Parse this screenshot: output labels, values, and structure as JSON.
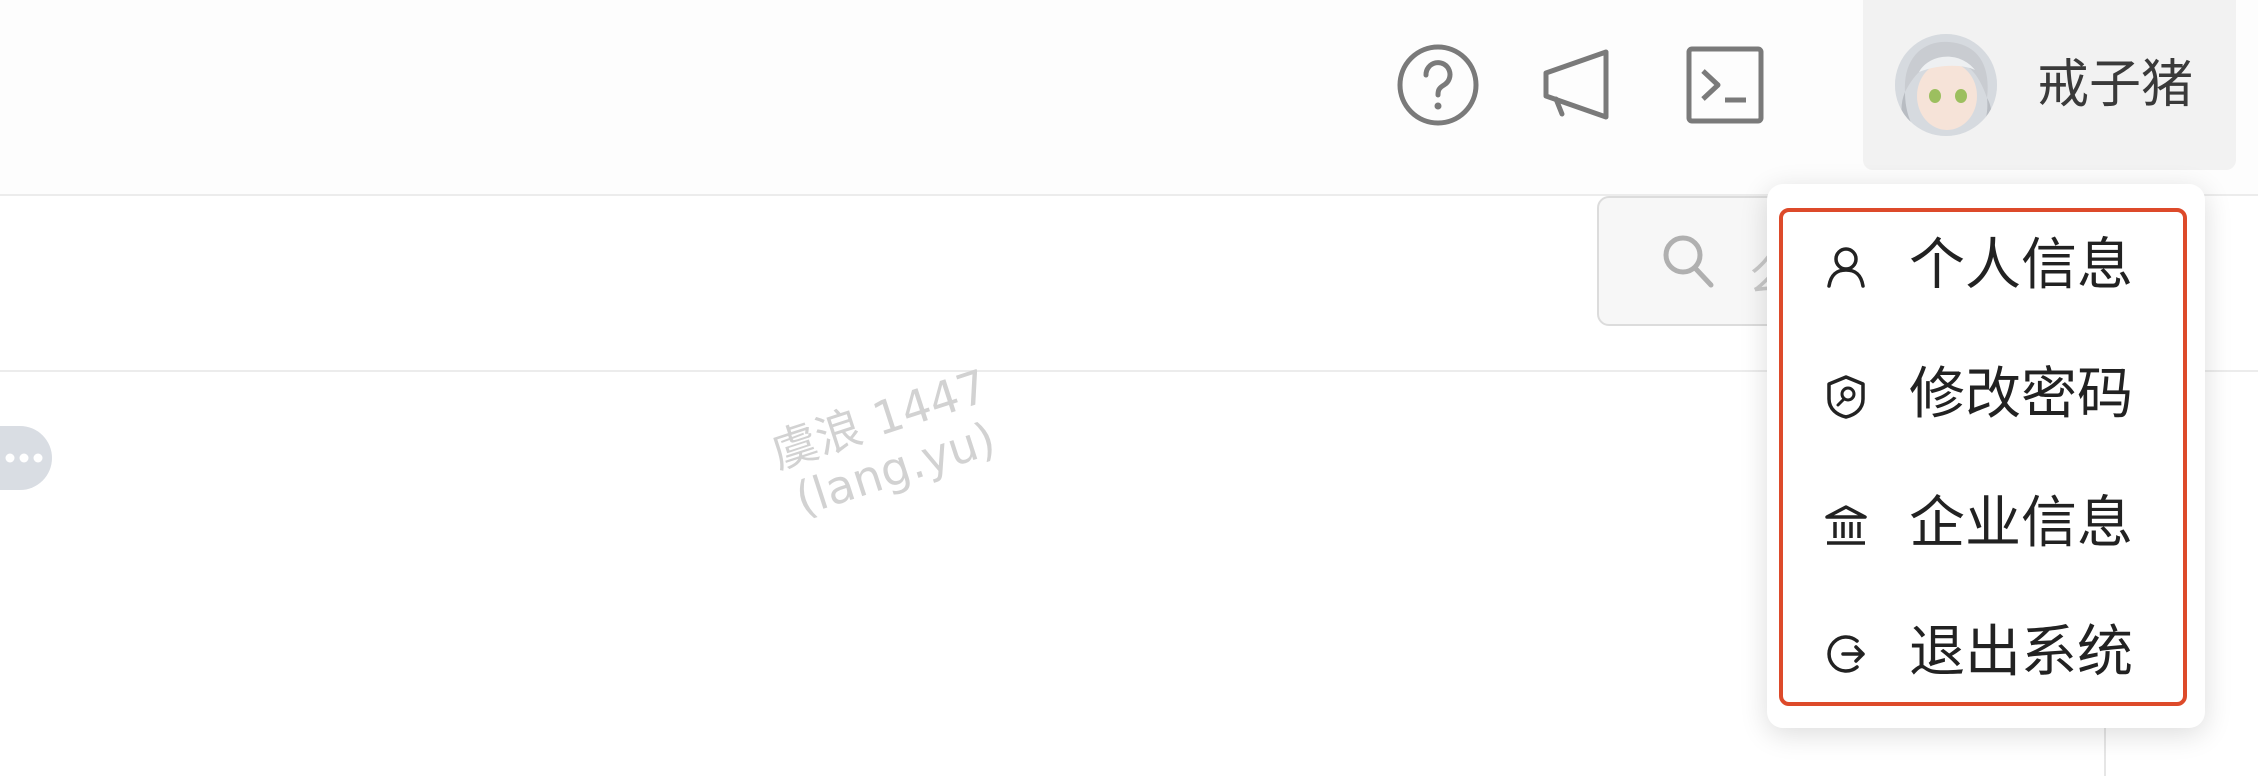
{
  "header": {
    "icons": [
      "help-circle-icon",
      "megaphone-icon",
      "terminal-icon"
    ],
    "user": {
      "name": "戒子猪",
      "avatar": "avatar-anime-girl"
    }
  },
  "search": {
    "placeholder": "么"
  },
  "watermark": {
    "line1": "虞浪 1447",
    "line2": "(lang.yu)"
  },
  "user_menu": {
    "items": [
      {
        "icon": "user-icon",
        "label": "个人信息"
      },
      {
        "icon": "shield-key-icon",
        "label": "修改密码"
      },
      {
        "icon": "bank-icon",
        "label": "企业信息"
      },
      {
        "icon": "logout-icon",
        "label": "退出系统"
      }
    ],
    "highlight_color": "#dd4a2a"
  }
}
